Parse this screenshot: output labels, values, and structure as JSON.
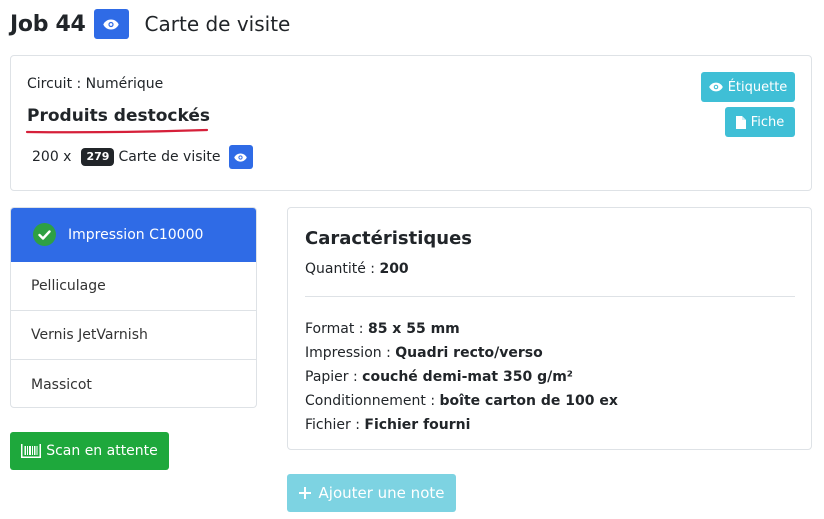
{
  "header": {
    "job_label": "Job 44",
    "job_name": "Carte de visite"
  },
  "summary": {
    "circuit": "Circuit : Numérique",
    "title": "Produits destockés",
    "quantity": "200 x",
    "badge": "279",
    "product": "Carte de visite",
    "buttons": {
      "etiquette": "Étiquette",
      "fiche": "Fiche"
    }
  },
  "steps": [
    {
      "label": "Impression C10000",
      "active": true,
      "done": true
    },
    {
      "label": "Pelliculage"
    },
    {
      "label": "Vernis JetVarnish"
    },
    {
      "label": "Massicot"
    }
  ],
  "scan_button": "Scan en attente",
  "characteristics": {
    "title": "Caractéristiques",
    "quantity_label": "Quantité : ",
    "quantity_value": "200",
    "specs": [
      {
        "label": "Format : ",
        "value": "85 x 55 mm"
      },
      {
        "label": "Impression : ",
        "value": "Quadri recto/verso"
      },
      {
        "label": "Papier : ",
        "value": "couché demi-mat 350 g/m²"
      },
      {
        "label": "Conditionnement : ",
        "value": "boîte carton de 100 ex"
      },
      {
        "label": "Fichier : ",
        "value": "Fichier fourni"
      }
    ]
  },
  "note_button": "Ajouter une note",
  "colors": {
    "primary": "#2f6be6",
    "info": "#3fbfd6",
    "success": "#1ea83c",
    "underline": "#d6203a"
  },
  "icons": {
    "view": "eye-icon",
    "file": "file-icon",
    "done": "check-circle-icon",
    "scan": "barcode-icon",
    "add": "plus-icon"
  }
}
